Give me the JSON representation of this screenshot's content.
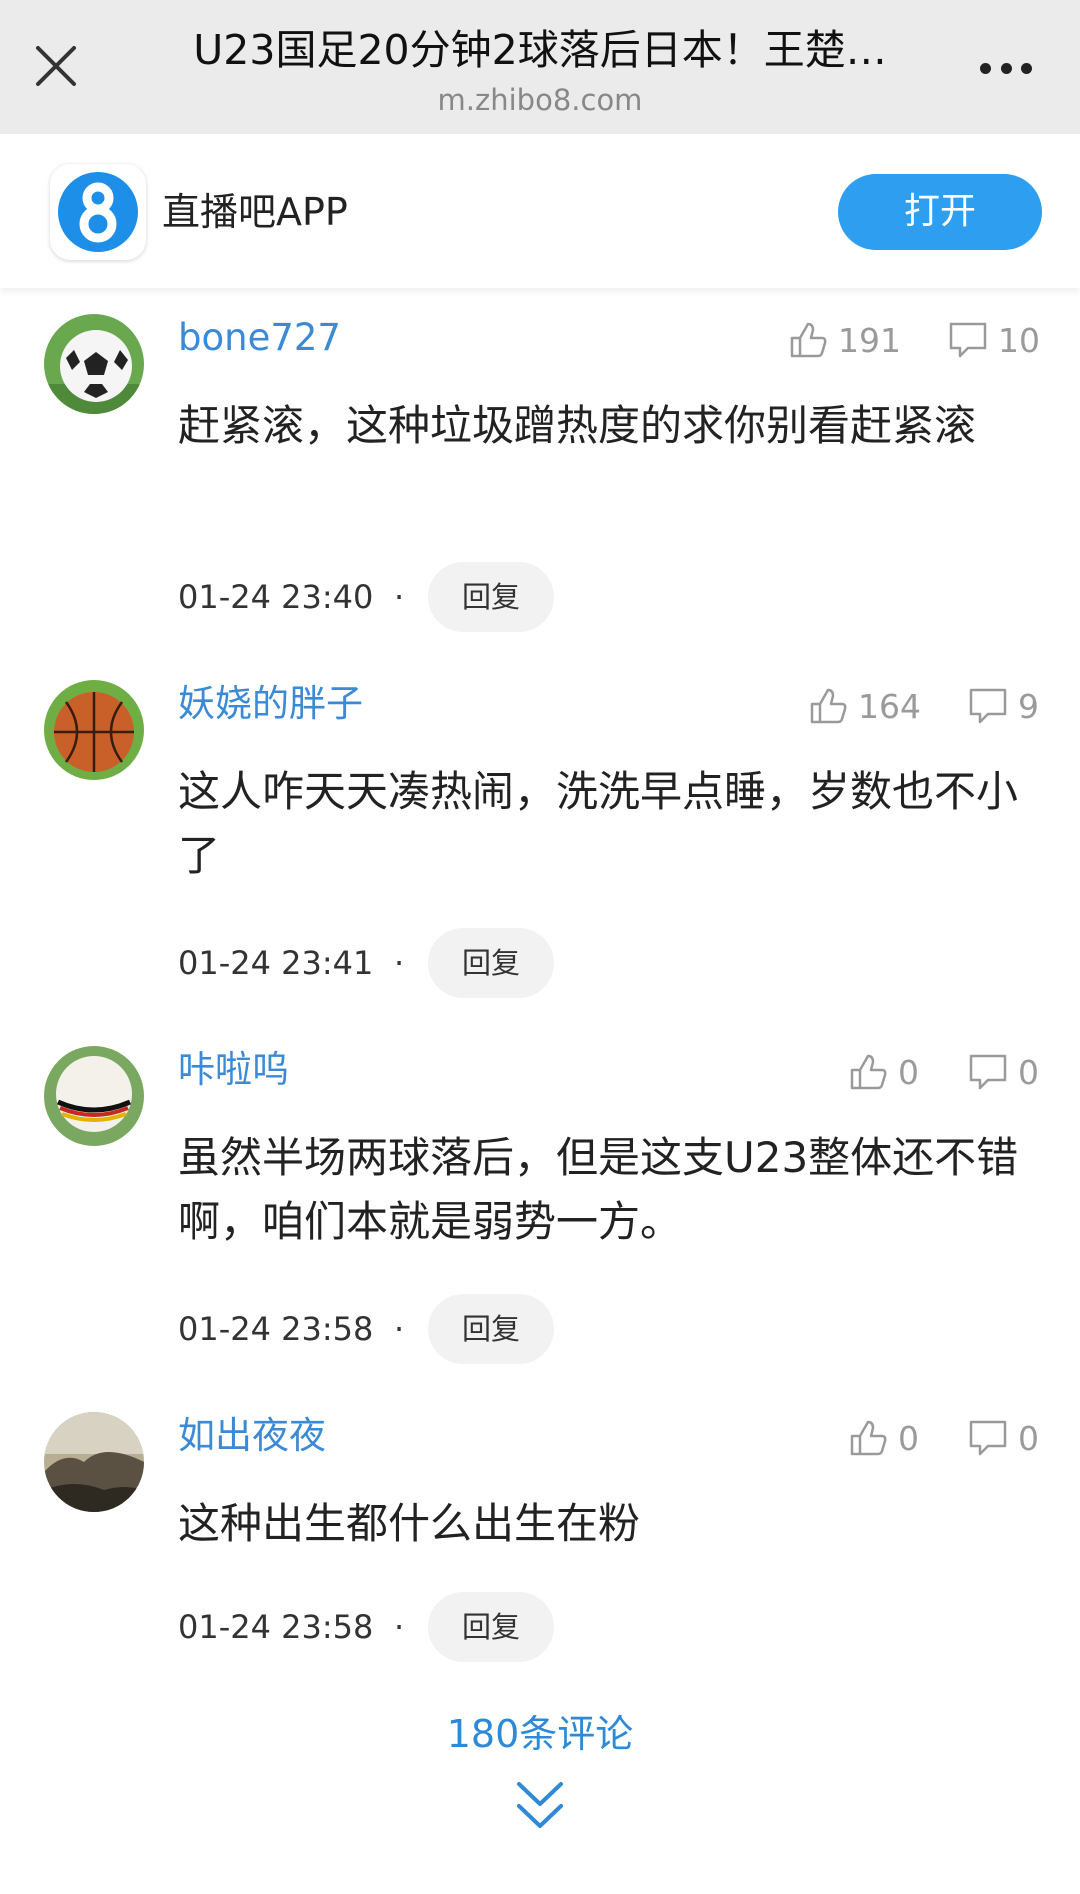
{
  "header": {
    "title": "U23国足20分钟2球落后日本！王楚…",
    "domain": "m.zhibo8.com"
  },
  "app_banner": {
    "app_name": "直播吧APP",
    "logo_glyph": "8",
    "open_label": "打开",
    "accent": "#2e9ef0"
  },
  "comments": [
    {
      "username": "bone727",
      "likes": "191",
      "replies": "10",
      "text": "赶紧滚，这种垃圾蹭热度的求你别看赶紧滚",
      "time": "01-24 23:40",
      "reply_label": "回复",
      "separator": "·"
    },
    {
      "username": "妖娆的胖子",
      "likes": "164",
      "replies": "9",
      "text": "这人咋天天凑热闹，洗洗早点睡，岁数也不小了",
      "time": "01-24 23:41",
      "reply_label": "回复",
      "separator": "·"
    },
    {
      "username": "咔啦呜",
      "likes": "0",
      "replies": "0",
      "text": "虽然半场两球落后，但是这支U23整体还不错啊，咱们本就是弱势一方。",
      "time": "01-24 23:58",
      "reply_label": "回复",
      "separator": "·"
    },
    {
      "username": "如出夜夜",
      "likes": "0",
      "replies": "0",
      "text": "这种出生都什么出生在粉",
      "time": "01-24 23:58",
      "reply_label": "回复",
      "separator": "·"
    }
  ],
  "footer": {
    "more_label": "180条评论"
  }
}
